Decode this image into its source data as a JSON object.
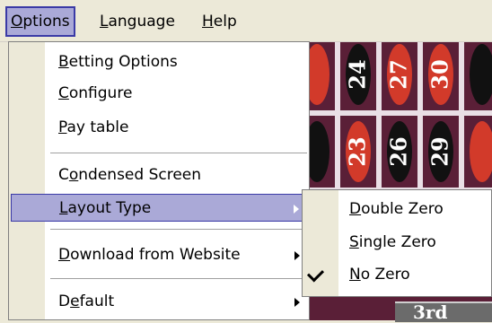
{
  "menubar": {
    "items": [
      {
        "access": "O",
        "rest": "ptions"
      },
      {
        "access": "L",
        "rest": "anguage"
      },
      {
        "access": "H",
        "rest": "elp"
      }
    ]
  },
  "options_menu": {
    "betting_options": {
      "access": "B",
      "rest": "etting Options"
    },
    "configure": {
      "access": "C",
      "rest": "onfigure"
    },
    "pay_table": {
      "access": "P",
      "rest": "ay table"
    },
    "condensed_screen": {
      "pre": "C",
      "access": "o",
      "rest": "ndensed Screen"
    },
    "layout_type": {
      "access": "L",
      "rest": "ayout Type"
    },
    "download_from_website": {
      "access": "D",
      "rest": "ownload from Website"
    },
    "default": {
      "pre": "D",
      "access": "e",
      "rest": "fault"
    }
  },
  "layout_submenu": {
    "double_zero": {
      "access": "D",
      "rest": "ouble Zero"
    },
    "single_zero": {
      "access": "S",
      "rest": "ingle Zero"
    },
    "no_zero": {
      "access": "N",
      "rest": "o Zero",
      "checked": true
    }
  },
  "board": {
    "row1": [
      "24",
      "27",
      "30"
    ],
    "row2": [
      "23",
      "26",
      "29"
    ],
    "dozen_label": "3rd"
  },
  "colors": {
    "menu_highlight": "#aaa9d7",
    "highlight_border": "#3a3aa6",
    "board_background": "#5a1f37",
    "red": "#d23a2a",
    "black": "#111111"
  }
}
